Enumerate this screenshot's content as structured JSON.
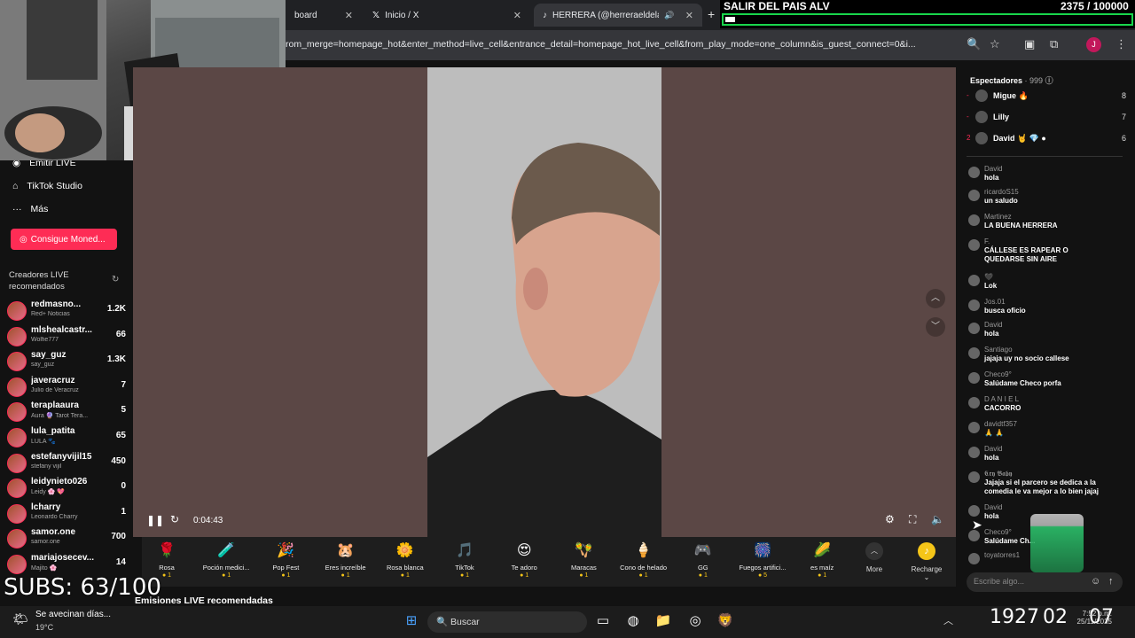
{
  "browser": {
    "tabs": [
      {
        "label": "board"
      },
      {
        "label": "Inicio / X"
      },
      {
        "label": "HERRERA (@herreraeldelah"
      }
    ],
    "url": "rom_merge=homepage_hot&enter_method=live_cell&entrance_detail=homepage_hot_live_cell&from_play_mode=one_column&is_guest_connect=0&i...",
    "profile_initial": "J"
  },
  "goal": {
    "title": "SALIR DEL PAIS ALV",
    "count": "2375 / 100000",
    "progress_fraction": 0.02375
  },
  "sidebar": {
    "nav": [
      {
        "label": "Emitir LIVE",
        "icon": "broadcast-icon"
      },
      {
        "label": "TikTok Studio",
        "icon": "home-icon"
      },
      {
        "label": "Más",
        "icon": "more-icon"
      }
    ],
    "coins_button": "Consigue Moned...",
    "section_title": "Creadores LIVE recomendados",
    "creators": [
      {
        "name": "redmasno...",
        "sub": "Red+ Noticias",
        "count": "1.2K"
      },
      {
        "name": "mlshealcastr...",
        "sub": "Wolfie777",
        "count": "66"
      },
      {
        "name": "say_guz",
        "sub": "say_guz",
        "count": "1.3K"
      },
      {
        "name": "javeracruz",
        "sub": "Julio de Veracruz",
        "count": "7"
      },
      {
        "name": "teraplaaura",
        "sub": "Aura 🔮 Tarot Tera...",
        "count": "5"
      },
      {
        "name": "lula_patita",
        "sub": "LULA 🐾",
        "count": "65"
      },
      {
        "name": "estefanyvijil15",
        "sub": "stefany vijil",
        "count": "450"
      },
      {
        "name": "leidynieto026",
        "sub": "Leidy 🌸 💖",
        "count": "0"
      },
      {
        "name": "lcharry",
        "sub": "Leonardo Charry",
        "count": "1"
      },
      {
        "name": "samor.one",
        "sub": "samor.one",
        "count": "700"
      },
      {
        "name": "mariajosecev...",
        "sub": "Majito 🌸",
        "count": "14"
      }
    ]
  },
  "video": {
    "time": "0:04:43"
  },
  "gifts": [
    {
      "name": "Rosa",
      "icon": "🌹",
      "cost": "1"
    },
    {
      "name": "Poción medici...",
      "icon": "🧪",
      "cost": "1"
    },
    {
      "name": "Pop Fest",
      "icon": "🎉",
      "cost": "1"
    },
    {
      "name": "Eres increíble",
      "icon": "🐹",
      "cost": "1"
    },
    {
      "name": "Rosa blanca",
      "icon": "🌼",
      "cost": "1"
    },
    {
      "name": "TikTok",
      "icon": "🎵",
      "cost": "1"
    },
    {
      "name": "Te adoro",
      "icon": "😍",
      "cost": "1"
    },
    {
      "name": "Maracas",
      "icon": "🪇",
      "cost": "1"
    },
    {
      "name": "Cono de helado",
      "icon": "🍦",
      "cost": "1"
    },
    {
      "name": "GG",
      "icon": "🎮",
      "cost": "1"
    },
    {
      "name": "Fuegos artifici...",
      "icon": "🎆",
      "cost": "5"
    },
    {
      "name": "es maíz",
      "icon": "🌽",
      "cost": "1"
    }
  ],
  "more_label": "More",
  "recharge_label": "Recharge ⌄",
  "bottom_title": "Emisiones LIVE recomendadas",
  "subs_overlay": "SUBS: 63/100",
  "chat": {
    "viewers_title": "Espectadores",
    "viewers_count": "· 999",
    "ranking": [
      {
        "rank": "-",
        "name": "Migue 🔥",
        "score": "8"
      },
      {
        "rank": "-",
        "name": "Lilly",
        "score": "7"
      },
      {
        "rank": "2",
        "name": "David 🤘 💎 ●",
        "score": "6"
      }
    ],
    "messages": [
      {
        "user": "David",
        "text": "hola"
      },
      {
        "user": "ricardoS15",
        "text": "un saludo"
      },
      {
        "user": "Martinez",
        "text": "LA BUENA HERRERA"
      },
      {
        "user": "F.",
        "text": "CÁLLESE ES RAPEAR O QUEDARSE SIN AIRE"
      },
      {
        "user": "🖤",
        "text": "Lok"
      },
      {
        "user": "Jos.01",
        "text": "busca oficio"
      },
      {
        "user": "David",
        "text": "hola"
      },
      {
        "user": "Santiago",
        "text": "jajaja uy no socio callese"
      },
      {
        "user": "Checo9°",
        "text": "Salúdame Checo porfa"
      },
      {
        "user": "D A N I E L",
        "text": "CACORRO"
      },
      {
        "user": "davidtf357",
        "text": "🙏 🙏"
      },
      {
        "user": "David",
        "text": "hola"
      },
      {
        "user": "𝕮𝖗𝖞 𝕭𝖆𝖇𝖞",
        "text": "Jajaja si el parcero se dedica a la comedia le va mejor a lo bien jajaj"
      },
      {
        "user": "David",
        "text": "hola"
      },
      {
        "user": "Checo9°",
        "text": "Salúdame Ch..."
      },
      {
        "user": "toyatorres1",
        "text": ""
      }
    ],
    "input_placeholder": "Escribe algo..."
  },
  "taskbar": {
    "weather_title": "Se avecinan días...",
    "weather_temp": "19°C",
    "search_placeholder": "Buscar",
    "big_numbers": [
      "1927",
      "02",
      "07"
    ],
    "small_time": "7:52 p.m.",
    "small_date": "25/11/2025"
  }
}
